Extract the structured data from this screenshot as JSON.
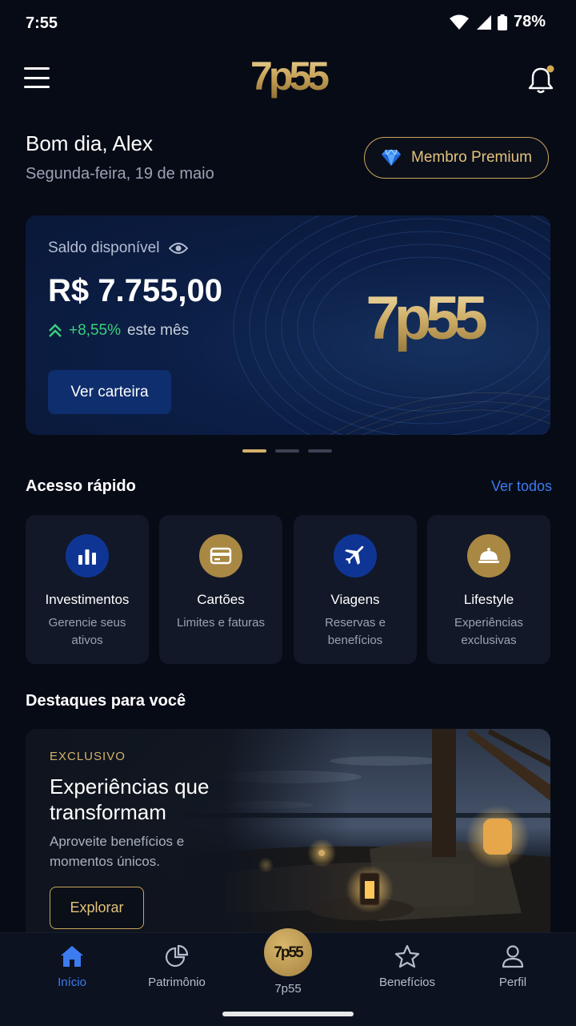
{
  "status_bar": {
    "time": "7:55",
    "battery": "78%"
  },
  "header": {
    "logo_text": "7p55"
  },
  "greeting": {
    "title": "Bom dia, Alex",
    "date": "Segunda-feira, 19 de maio"
  },
  "membership": {
    "label": "Membro Premium"
  },
  "balance_card": {
    "label": "Saldo disponível",
    "amount": "R$ 7.755,00",
    "change_pct": "+8,55%",
    "change_suffix": "este mês",
    "button": "Ver carteira",
    "logo_text": "7p55",
    "pages": 3,
    "active_page": 1
  },
  "quick_access": {
    "title": "Acesso rápido",
    "see_all": "Ver todos",
    "items": [
      {
        "name": "Investimentos",
        "desc": "Gerencie seus ativos",
        "icon": "bar-chart-icon"
      },
      {
        "name": "Cartões",
        "desc": "Limites e faturas",
        "icon": "credit-card-icon"
      },
      {
        "name": "Viagens",
        "desc": "Reservas e benefícios",
        "icon": "airplane-icon"
      },
      {
        "name": "Lifestyle",
        "desc": "Experiências exclusivas",
        "icon": "cloche-icon"
      }
    ]
  },
  "highlights": {
    "title": "Destaques para você",
    "card": {
      "tag": "EXCLUSIVO",
      "headline": "Experiências que transformam",
      "desc": "Aproveite benefícios e momentos únicos.",
      "button": "Explorar"
    }
  },
  "bottom_nav": {
    "items": [
      {
        "label": "Início",
        "icon": "home-icon",
        "active": true
      },
      {
        "label": "Patrimônio",
        "icon": "pie-chart-icon",
        "active": false
      },
      {
        "label": "7p55",
        "icon": "logo-icon",
        "active": false
      },
      {
        "label": "Benefícios",
        "icon": "star-icon",
        "active": false
      },
      {
        "label": "Perfil",
        "icon": "user-icon",
        "active": false
      }
    ]
  },
  "colors": {
    "gold": "#d4b16a",
    "accent_blue": "#3c7bf0",
    "positive": "#3ad07a",
    "background": "#070b16"
  }
}
